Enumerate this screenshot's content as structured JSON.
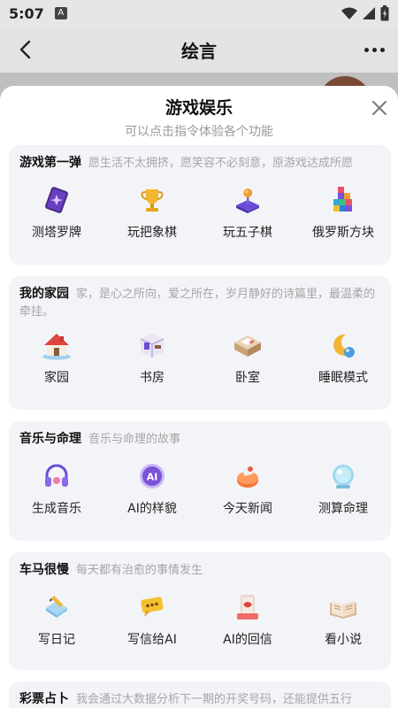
{
  "status_bar": {
    "time": "5:07",
    "badge": "A"
  },
  "app_bar": {
    "title": "绘言"
  },
  "sheet": {
    "title": "游戏娱乐",
    "subtitle": "可以点击指令体验各个功能"
  },
  "sections": [
    {
      "name": "游戏第一弹",
      "desc": "愿生活不太拥挤，愿笑容不必刻意，原游戏达成所愿",
      "items": [
        {
          "label": "测塔罗牌",
          "icon": "tarot-icon"
        },
        {
          "label": "玩把象棋",
          "icon": "trophy-icon"
        },
        {
          "label": "玩五子棋",
          "icon": "joystick-icon"
        },
        {
          "label": "俄罗斯方块",
          "icon": "blocks-icon"
        }
      ]
    },
    {
      "name": "我的家园",
      "desc": "家，是心之所向，爱之所在，岁月静好的诗篇里，最温柔的牵挂。",
      "items": [
        {
          "label": "家园",
          "icon": "house-icon"
        },
        {
          "label": "书房",
          "icon": "study-room-icon"
        },
        {
          "label": "卧室",
          "icon": "bedroom-icon"
        },
        {
          "label": "睡眠模式",
          "icon": "moon-icon"
        }
      ]
    },
    {
      "name": "音乐与命理",
      "desc": "音乐与命理的故事",
      "items": [
        {
          "label": "生成音乐",
          "icon": "headphones-icon"
        },
        {
          "label": "AI的样貌",
          "icon": "ai-badge-icon"
        },
        {
          "label": "今天新闻",
          "icon": "news-icon"
        },
        {
          "label": "测算命理",
          "icon": "crystal-ball-icon"
        }
      ]
    },
    {
      "name": "车马很慢",
      "desc": "每天都有治愈的事情发生",
      "items": [
        {
          "label": "写日记",
          "icon": "diary-icon"
        },
        {
          "label": "写信给AI",
          "icon": "chat-bubble-icon"
        },
        {
          "label": "AI的回信",
          "icon": "letter-phone-icon"
        },
        {
          "label": "看小说",
          "icon": "open-book-icon"
        }
      ]
    },
    {
      "name": "彩票占卜",
      "desc": "我会通过大数据分析下一期的开奖号码，还能提供五行",
      "items": []
    }
  ]
}
